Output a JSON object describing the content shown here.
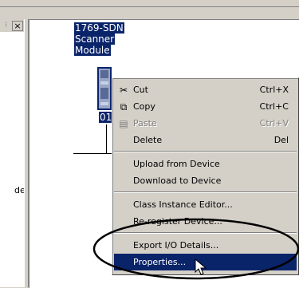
{
  "left_pane": {
    "close_label": "×",
    "partial_text": "de"
  },
  "device": {
    "label_lines": [
      "1769-SDN",
      "Scanner",
      "Module"
    ],
    "node_number": "01"
  },
  "context_menu": {
    "items": [
      {
        "label": "Cut",
        "accel": "Ctrl+X",
        "icon": "scissors-icon",
        "enabled": true
      },
      {
        "label": "Copy",
        "accel": "Ctrl+C",
        "icon": "copy-icon",
        "enabled": true
      },
      {
        "label": "Paste",
        "accel": "Ctrl+V",
        "icon": "paste-icon",
        "enabled": false
      },
      {
        "label": "Delete",
        "accel": "Del",
        "icon": "",
        "enabled": true
      },
      {
        "label": "Upload from Device",
        "accel": "",
        "icon": "",
        "enabled": true
      },
      {
        "label": "Download to Device",
        "accel": "",
        "icon": "",
        "enabled": true
      },
      {
        "label": "Class Instance Editor...",
        "accel": "",
        "icon": "",
        "enabled": true
      },
      {
        "label": "Re-register Device...",
        "accel": "",
        "icon": "",
        "enabled": true
      },
      {
        "label": "Export I/O Details...",
        "accel": "",
        "icon": "",
        "enabled": true
      },
      {
        "label": "Properties...",
        "accel": "",
        "icon": "",
        "enabled": true,
        "highlighted": true
      }
    ]
  },
  "colors": {
    "selection": "#0a246a",
    "menu_bg": "#d4d0c8",
    "annotation": "#000000"
  }
}
